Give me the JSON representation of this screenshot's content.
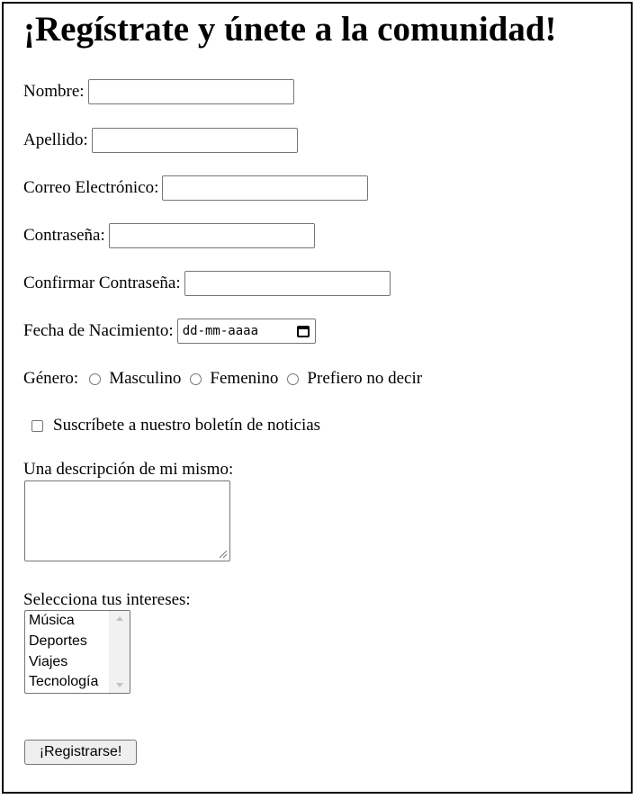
{
  "title": "¡Regístrate y únete a la comunidad!",
  "fields": {
    "nombre": {
      "label": "Nombre:",
      "value": ""
    },
    "apellido": {
      "label": "Apellido:",
      "value": ""
    },
    "correo": {
      "label": "Correo Electrónico:",
      "value": ""
    },
    "contrasena": {
      "label": "Contraseña:",
      "value": ""
    },
    "confirmar": {
      "label": "Confirmar Contraseña:",
      "value": ""
    },
    "fecha": {
      "label": "Fecha de Nacimiento:",
      "placeholder": "dd-mm-aaaa"
    }
  },
  "genero": {
    "label": "Género:",
    "options": [
      "Masculino",
      "Femenino",
      "Prefiero no decir"
    ],
    "selected": null
  },
  "boletin": {
    "label": "Suscríbete a nuestro boletín de noticias",
    "checked": false
  },
  "descripcion": {
    "label": "Una descripción de mi mismo:",
    "value": ""
  },
  "intereses": {
    "label": "Selecciona tus intereses:",
    "options": [
      "Música",
      "Deportes",
      "Viajes",
      "Tecnología"
    ]
  },
  "submit_label": "¡Registrarse!",
  "icons": {
    "date": "calendar-icon",
    "resize": "resize-grip-icon"
  }
}
